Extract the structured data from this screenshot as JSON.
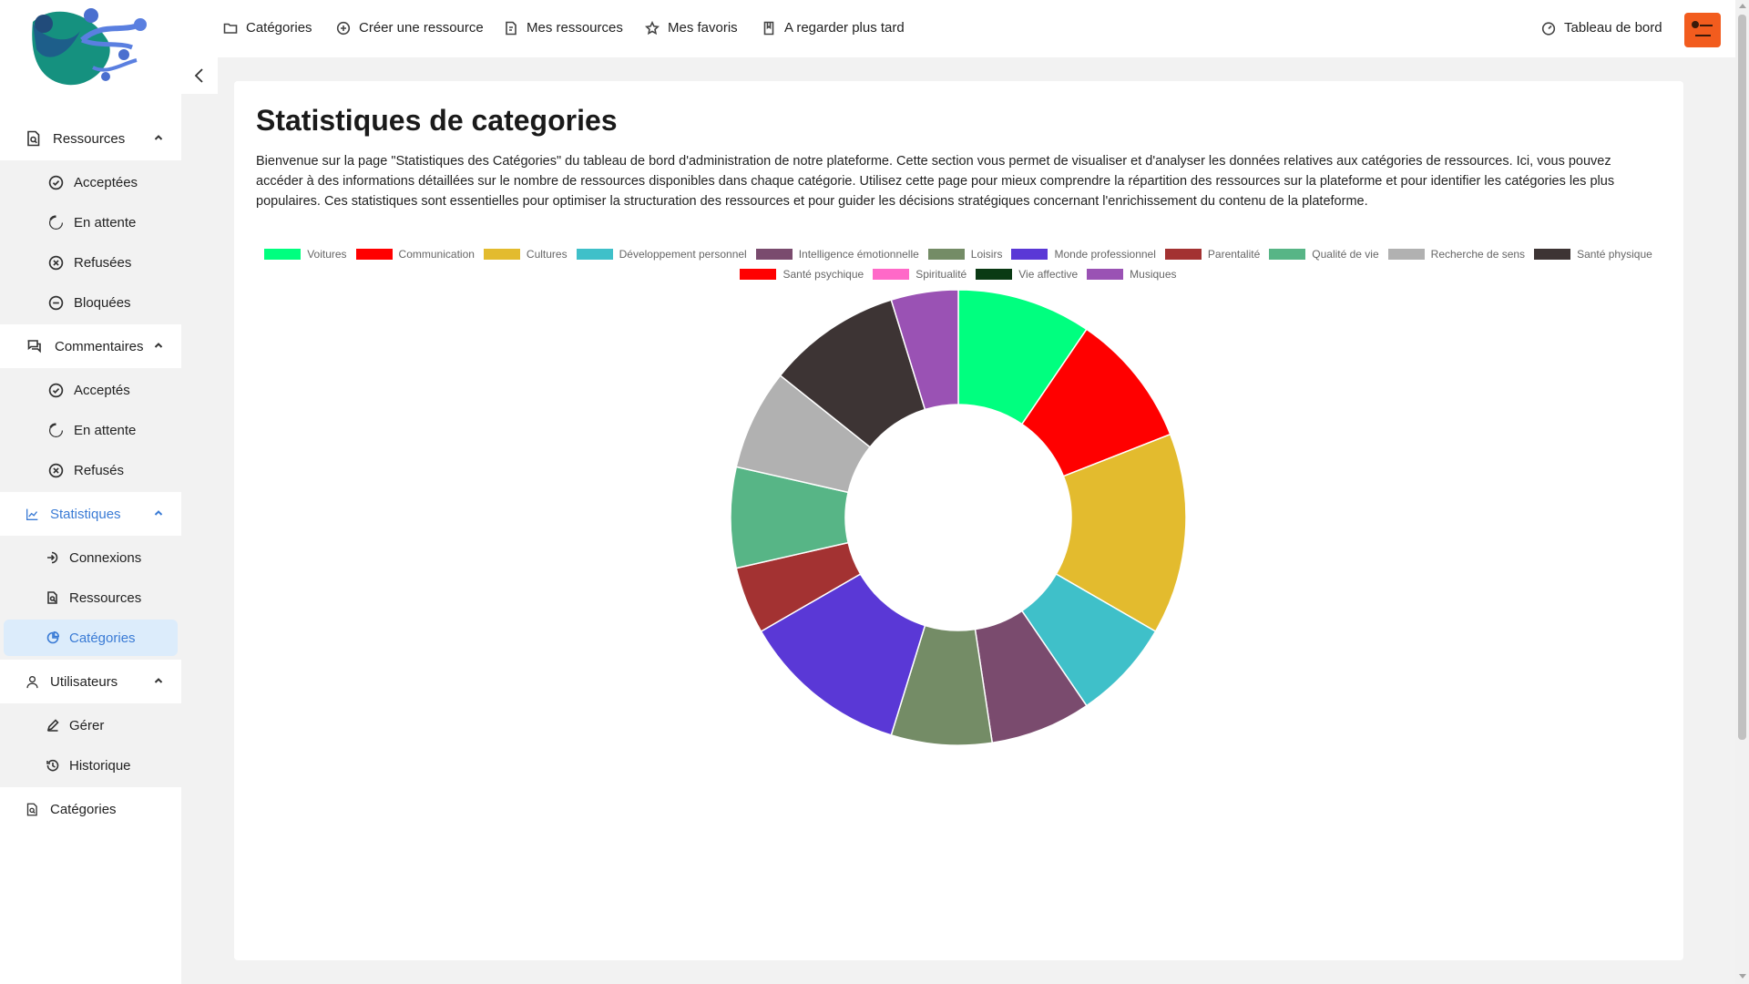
{
  "topnav": {
    "categories": "Catégories",
    "create": "Créer une ressource",
    "mine": "Mes ressources",
    "favorites": "Mes favoris",
    "watch_later": "A regarder plus tard",
    "dashboard": "Tableau de bord"
  },
  "sidebar": {
    "resources": {
      "label": "Ressources",
      "items": [
        "Acceptées",
        "En attente",
        "Refusées",
        "Bloquées"
      ]
    },
    "comments": {
      "label": "Commentaires",
      "items": [
        "Acceptés",
        "En attente",
        "Refusés"
      ]
    },
    "stats": {
      "label": "Statistiques",
      "items": [
        "Connexions",
        "Ressources",
        "Catégories"
      ]
    },
    "users": {
      "label": "Utilisateurs",
      "items": [
        "Gérer",
        "Historique"
      ]
    },
    "categories": {
      "label": "Catégories"
    }
  },
  "main": {
    "title": "Statistiques de categories",
    "intro": "Bienvenue sur la page \"Statistiques des Catégories\" du tableau de bord d'administration de notre plateforme. Cette section vous permet de visualiser et d'analyser les données relatives aux catégories de ressources. Ici, vous pouvez accéder à des informations détaillées sur le nombre de ressources disponibles dans chaque catégorie. Utilisez cette page pour mieux comprendre la répartition des ressources sur la plateforme et pour identifier les catégories les plus populaires. Ces statistiques sont essentielles pour optimiser la structuration des ressources et pour guider les décisions stratégiques concernant l'enrichissement du contenu de la plateforme."
  },
  "chart_data": {
    "type": "pie",
    "donut": true,
    "legend_position": "top",
    "categories": [
      "Voitures",
      "Communication",
      "Cultures",
      "Développement personnel",
      "Intelligence émotionnelle",
      "Loisirs",
      "Monde professionnel",
      "Parentalité",
      "Qualité de vie",
      "Recherche de sens",
      "Santé physique",
      "Santé psychique",
      "Spiritualité",
      "Vie affective",
      "Musiques"
    ],
    "values": [
      2,
      2,
      3,
      1.5,
      1.5,
      1.5,
      2.5,
      1,
      1.5,
      1.5,
      2,
      0,
      0,
      0,
      1
    ],
    "colors": [
      "#00ff7f",
      "#ff0000",
      "#e3bb2e",
      "#3fc0c9",
      "#7a4b6e",
      "#748c66",
      "#5a38d6",
      "#a33232",
      "#57b586",
      "#b1b1b1",
      "#3d3434",
      "#ff0000",
      "#ff69c8",
      "#0a3a14",
      "#9a52b4"
    ]
  },
  "colors": {
    "accent": "#3a7bd5",
    "user_button": "#f25c1e",
    "active_bg": "#dcecfb"
  }
}
